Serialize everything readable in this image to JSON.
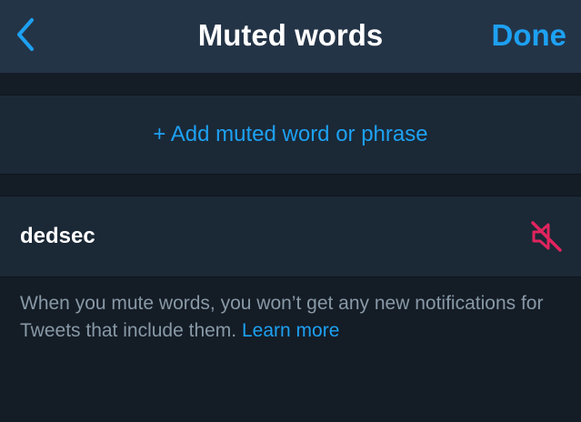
{
  "header": {
    "title": "Muted words",
    "done_label": "Done",
    "back_icon": "chevron-left-icon"
  },
  "add_row": {
    "label": "+ Add muted word or phrase"
  },
  "muted_words": [
    {
      "word": "dedsec",
      "icon": "muted-speaker-icon",
      "icon_color": "#e0245e"
    }
  ],
  "footnote": {
    "text": "When you mute words, you won’t get any new notifications for Tweets that include them.",
    "link": "Learn more"
  },
  "colors": {
    "accent": "#1da1f2",
    "nav_bg": "#243447",
    "page_bg": "#141c26",
    "row_bg": "#1b2836",
    "muted_text": "#8899a6",
    "mute_icon": "#e0245e"
  }
}
